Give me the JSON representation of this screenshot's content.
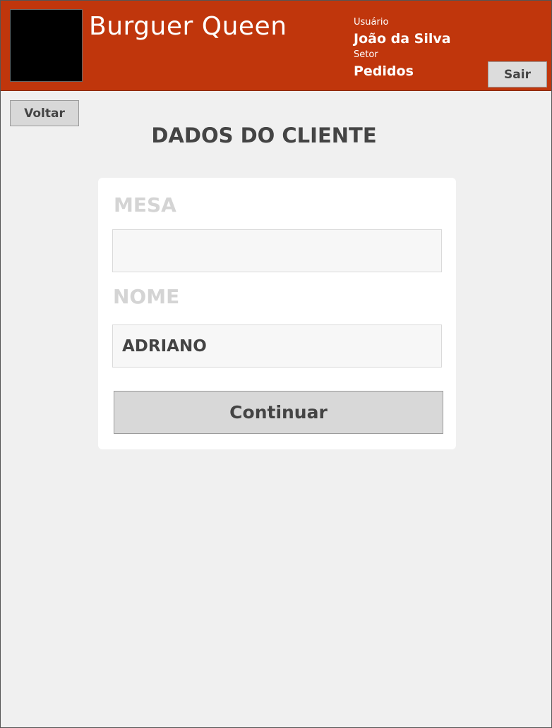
{
  "header": {
    "brand": "Burguer Queen",
    "user_caption": "Usuário",
    "user_name": "João da Silva",
    "sector_caption": "Setor",
    "sector_name": "Pedidos",
    "logout_label": "Sair"
  },
  "nav": {
    "back_label": "Voltar"
  },
  "page": {
    "title": "DADOS DO CLIENTE"
  },
  "form": {
    "table_label": "MESA",
    "table_value": "",
    "name_label": "NOME",
    "name_value": "ADRIANO",
    "continue_label": "Continuar"
  },
  "colors": {
    "header_bg": "#c0360c",
    "page_bg": "#f0f0f0",
    "card_bg": "#ffffff",
    "button_bg": "#d8d8d8",
    "label_muted": "#d4d4d4",
    "text_dark": "#444444"
  }
}
